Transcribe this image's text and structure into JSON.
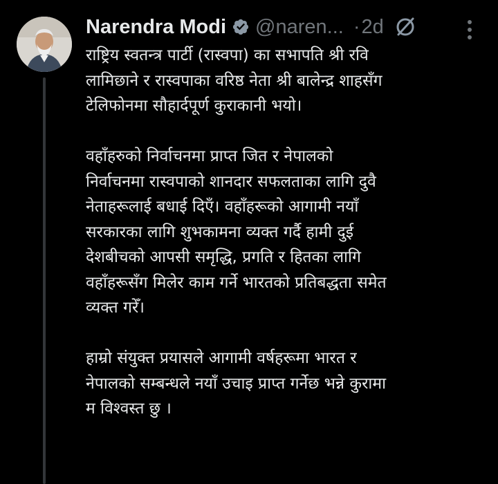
{
  "tweet": {
    "author_name": "Narendra Modi",
    "handle": "@naren...",
    "separator": "·",
    "timestamp": "2d",
    "paragraphs": [
      "राष्ट्रिय स्वतन्त्र पार्टी (रास्वपा) का सभापति श्री रवि\nलामिछाने र  रास्वपाका वरिष्ठ नेता श्री बालेन्द्र शाहसँग\nटेलिफोनमा सौहार्दपूर्ण कुराकानी भयो।",
      "वहाँहरुको निर्वाचनमा प्राप्त जित र नेपालको\nनिर्वाचनमा रास्वपाको शानदार सफलताका लागि दुवै\nनेताहरूलाई बधाई दिएँ। वहाँहरूको आगामी नयाँ\nसरकारका लागि शुभकामना व्यक्त गर्दै हामी दुई\nदेशबीचको आपसी समृद्धि, प्रगति र हितका लागि\nवहाँहरूसँग मिलेर काम गर्ने भारतको प्रतिबद्धता समेत\nव्यक्त गरेँ।",
      "हाम्रो संयुक्त प्रयासले आगामी वर्षहरूमा भारत र\nनेपालको सम्बन्धले नयाँ उचाइ प्राप्त गर्नेछ भन्ने कुरामा\nम विश्वस्त छु ।"
    ]
  },
  "icons": {
    "verified": "verified-badge-icon",
    "grok": "grok-icon",
    "more": "more-options-icon"
  },
  "colors": {
    "background": "#000000",
    "text_primary": "#e7e9ea",
    "text_secondary": "#71767b",
    "thread_line": "#333639"
  }
}
